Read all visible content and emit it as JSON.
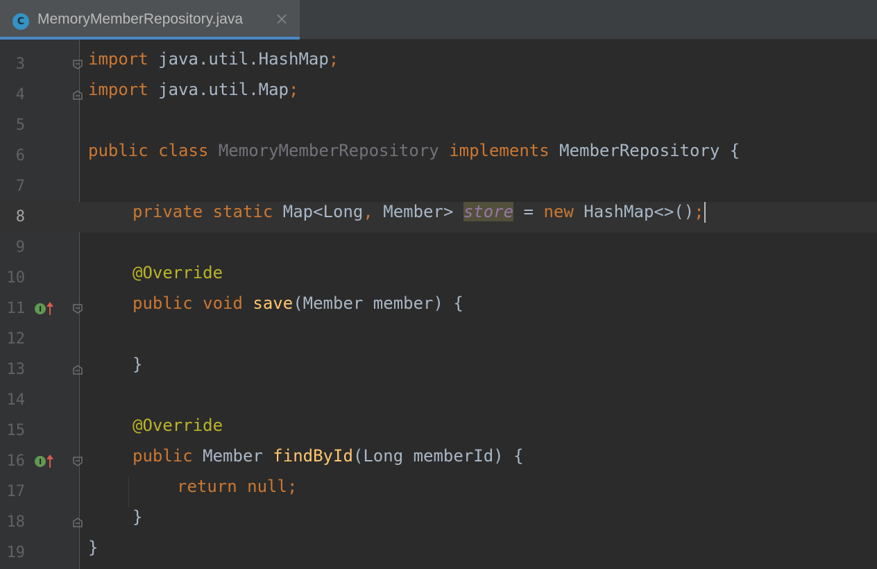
{
  "tab": {
    "badge": "C",
    "title": "MemoryMemberRepository.java",
    "close": "×"
  },
  "editor": {
    "current_line": "8",
    "line_numbers": [
      "3",
      "4",
      "5",
      "6",
      "7",
      "8",
      "9",
      "10",
      "11",
      "12",
      "13",
      "14",
      "15",
      "16",
      "17",
      "18",
      "19"
    ],
    "lines": {
      "l3": {
        "kw": "import",
        "rest": " java.util.HashMap",
        "semi": ";"
      },
      "l4": {
        "kw": "import",
        "rest": " java.util.Map",
        "semi": ";"
      },
      "l6": {
        "kw": "public class",
        "cls": "MemoryMemberRepository",
        "kw2": "implements",
        "rest": " MemberRepository {"
      },
      "l8": {
        "kw": "private static",
        "t1": " Map<Long",
        "comma": ",",
        "t2": " Member> ",
        "field": "store",
        "eq": " = ",
        "kw2": "new",
        "t3": " HashMap<>()",
        "semi": ";"
      },
      "l10": {
        "ann": "@Override"
      },
      "l11": {
        "kw": "public void",
        "fn": "save",
        "rest": "(Member member) {"
      },
      "l13": {
        "rest": "}"
      },
      "l15": {
        "ann": "@Override"
      },
      "l16": {
        "kw": "public",
        "t1": " Member ",
        "fn": "findById",
        "rest": "(Long memberId) {"
      },
      "l17": {
        "kw": "return null",
        "semi": ";"
      },
      "l18": {
        "rest": "}"
      },
      "l19": {
        "rest": "}"
      }
    },
    "gutter_icons": {
      "l11": "implementing-method-icon",
      "l16": "implementing-method-icon"
    }
  },
  "colors": {
    "background": "#2b2b2b",
    "keyword": "#cc7832",
    "annotation": "#bbb529",
    "method": "#ffc66d",
    "field": "#9876aa",
    "default_text": "#a9b7c6",
    "tab_underline": "#4a88c7"
  }
}
